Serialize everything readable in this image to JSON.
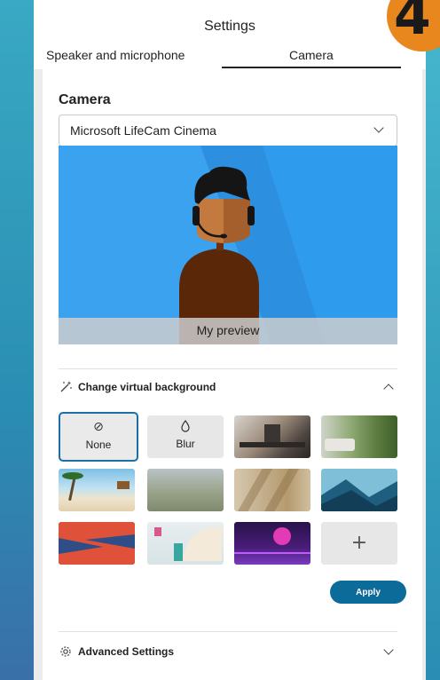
{
  "step_badge": "4",
  "window": {
    "title": "Settings",
    "tabs": [
      {
        "label": "Speaker and microphone",
        "active": false
      },
      {
        "label": "Camera",
        "active": true
      }
    ]
  },
  "camera": {
    "heading": "Camera",
    "device_select": {
      "value": "Microsoft LifeCam Cinema",
      "icon": "chevron-down-icon"
    },
    "preview_label": "My preview"
  },
  "virtual_background": {
    "heading": "Change virtual background",
    "icon": "magic-wand-icon",
    "expanded": true,
    "tiles": [
      {
        "type": "none",
        "label": "None",
        "glyph": "⊘",
        "selected": true
      },
      {
        "type": "blur",
        "label": "Blur",
        "glyph": "💧"
      },
      {
        "type": "image",
        "name": "office-interior"
      },
      {
        "type": "image",
        "name": "garden-living-room"
      },
      {
        "type": "image",
        "name": "beach-hut"
      },
      {
        "type": "image",
        "name": "blurred-landscape"
      },
      {
        "type": "image",
        "name": "window-shadows"
      },
      {
        "type": "image",
        "name": "mountains-illustration"
      },
      {
        "type": "image",
        "name": "red-abstract"
      },
      {
        "type": "image",
        "name": "pastel-room"
      },
      {
        "type": "image",
        "name": "purple-neon"
      },
      {
        "type": "add",
        "glyph": "+"
      }
    ],
    "apply_label": "Apply"
  },
  "advanced": {
    "heading": "Advanced Settings",
    "icon": "gear-icon",
    "expanded": false
  },
  "colors": {
    "accent": "#0d6b99",
    "selected_border": "#1b6fa6",
    "preview_bg": "#2f9bec",
    "badge": "#e8871e"
  }
}
